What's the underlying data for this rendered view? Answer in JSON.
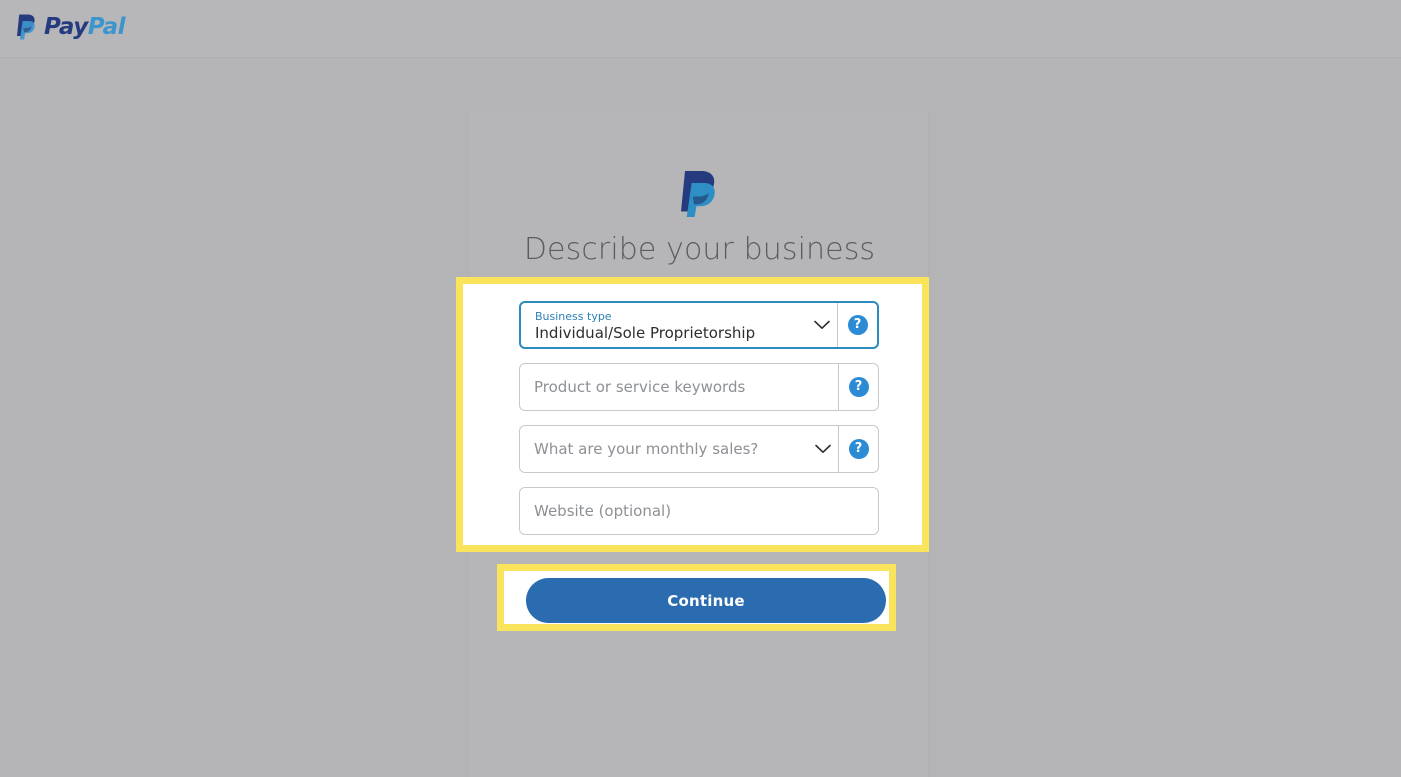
{
  "header": {
    "brand_name_part1": "Pay",
    "brand_name_part2": "Pal",
    "logo_icon": "paypal-logo-icon"
  },
  "card": {
    "logo_icon": "paypal-monogram-icon",
    "title": "Describe your business"
  },
  "form": {
    "fields": [
      {
        "name": "business-type",
        "label": "Business type",
        "value": "Individual/Sole Proprietorship",
        "type": "select",
        "focused": true,
        "has_help": true,
        "help_label": "?"
      },
      {
        "name": "product-keywords",
        "placeholder": "Product or service keywords",
        "value": "",
        "type": "text",
        "focused": false,
        "has_help": true,
        "help_label": "?"
      },
      {
        "name": "monthly-sales",
        "placeholder": "What are your monthly sales?",
        "value": "",
        "type": "select",
        "focused": false,
        "has_help": true,
        "help_label": "?"
      },
      {
        "name": "website",
        "placeholder": "Website (optional)",
        "value": "",
        "type": "text",
        "focused": false,
        "has_help": false,
        "help_label": ""
      }
    ]
  },
  "actions": {
    "continue_label": "Continue"
  },
  "colors": {
    "page_background": "#b4b4b6",
    "highlight_yellow": "#f9e45c",
    "brand_dark_blue": "#253b80",
    "brand_light_blue": "#3d95ce",
    "focus_border": "#2b8bbd",
    "help_badge_blue": "#2b8bd4",
    "button_blue": "#2b6cb0",
    "title_gray": "#5d5d60",
    "placeholder_gray": "#8d9094"
  }
}
